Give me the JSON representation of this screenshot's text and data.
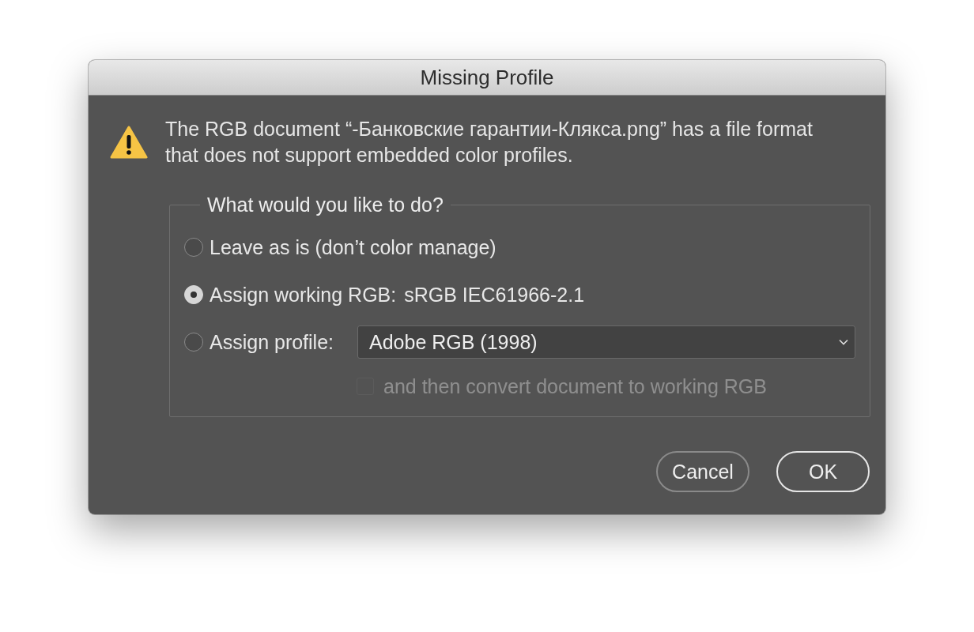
{
  "window": {
    "title": "Missing Profile"
  },
  "message": "The RGB document “-Банковские гарантии-Клякса.png” has a file format that does not support embedded color profiles.",
  "group": {
    "legend": "What would you like to do?",
    "options": [
      {
        "kind": "radio",
        "label": "Leave as is (don’t color manage)",
        "selected": false
      },
      {
        "kind": "radio-value",
        "label": "Assign working RGB:",
        "value": "sRGB IEC61966-2.1",
        "selected": true
      },
      {
        "kind": "radio-select",
        "label": "Assign profile:",
        "select": "Adobe RGB (1998)",
        "selected": false
      }
    ],
    "convert": {
      "label": "and then convert document to working RGB",
      "checked": false,
      "disabled": true
    }
  },
  "buttons": [
    {
      "label": "Cancel",
      "default": false
    },
    {
      "label": "OK",
      "default": true
    }
  ]
}
